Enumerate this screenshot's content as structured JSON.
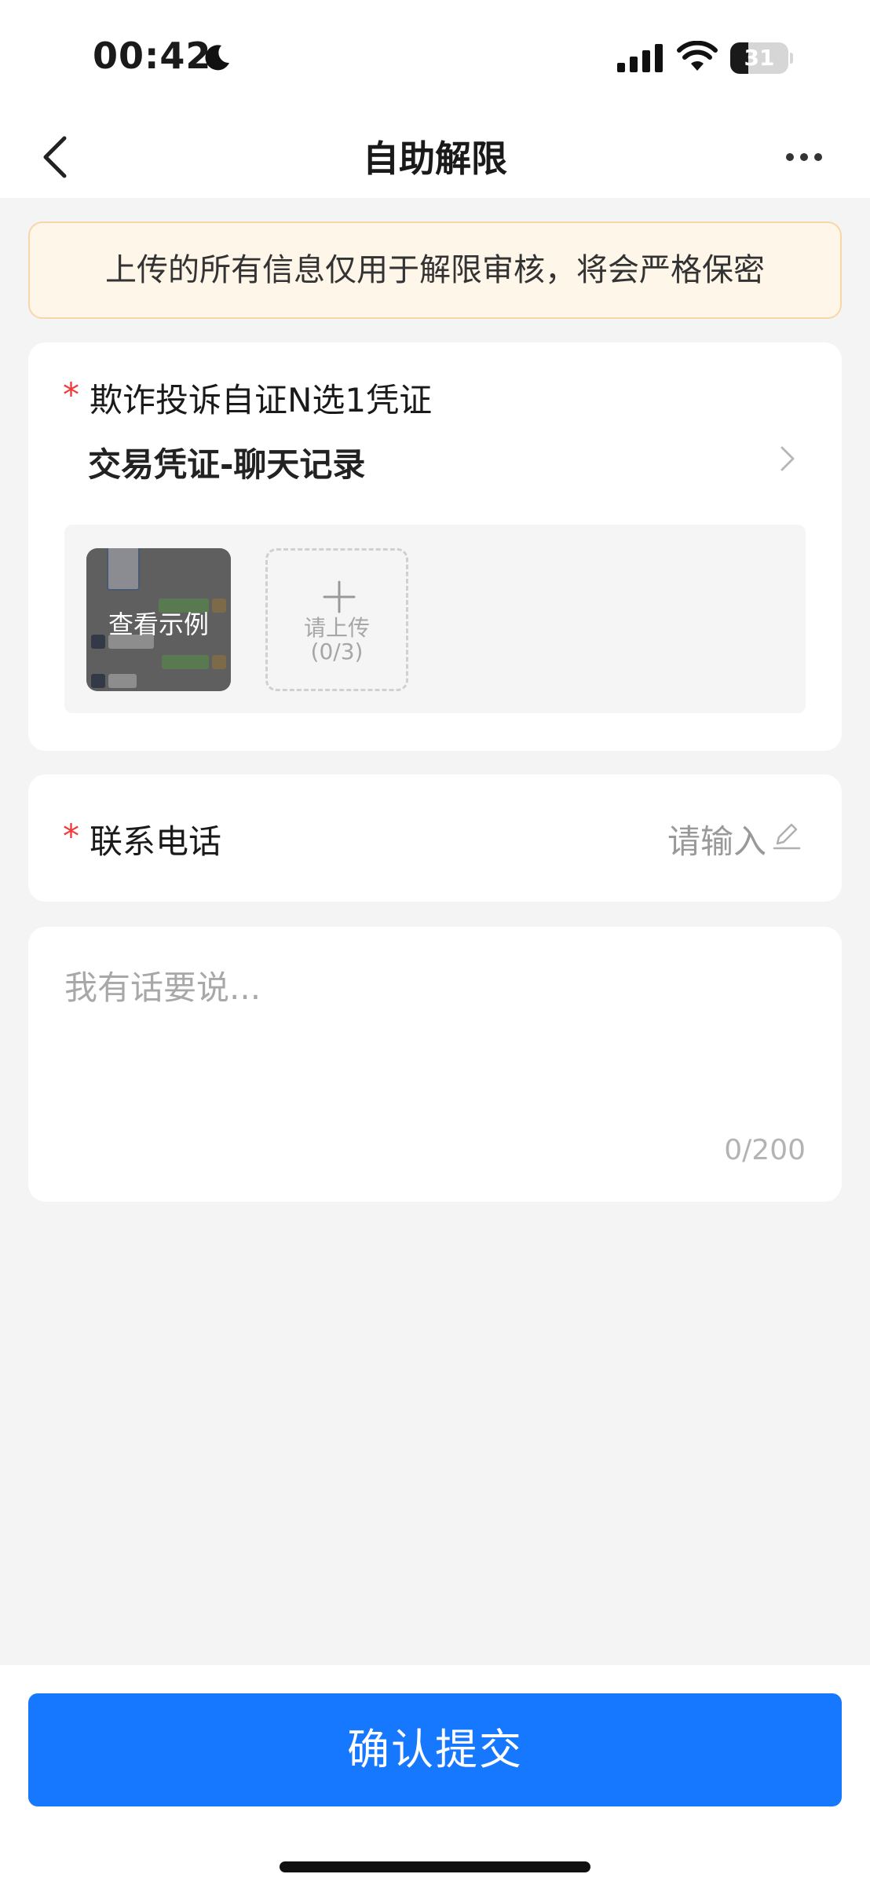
{
  "status_bar": {
    "time": "00:42",
    "battery_level": "31",
    "battery_fraction": 0.31,
    "icons": [
      "moon-icon",
      "signal-icon",
      "wifi-icon",
      "battery-icon"
    ]
  },
  "nav": {
    "title": "自助解限",
    "icons": [
      "chevron-left-icon",
      "more-dots-icon"
    ]
  },
  "notice": {
    "text": "上传的所有信息仅用于解限审核，将会严格保密"
  },
  "evidence": {
    "required_mark": "*",
    "label": "欺诈投诉自证N选1凭证",
    "selected_type": "交易凭证-聊天记录",
    "example_label": "查看示例",
    "upload_label": "请上传",
    "upload_count": "(0/3)"
  },
  "phone": {
    "required_mark": "*",
    "label": "联系电话",
    "placeholder": "请输入"
  },
  "remark": {
    "placeholder": "我有话要说...",
    "count": "0/200"
  },
  "footer": {
    "submit_label": "确认提交"
  },
  "colors": {
    "primary": "#1677ff",
    "required": "#f03a3a",
    "notice_bg": "#fff6ea",
    "page_bg": "#f4f4f4"
  }
}
